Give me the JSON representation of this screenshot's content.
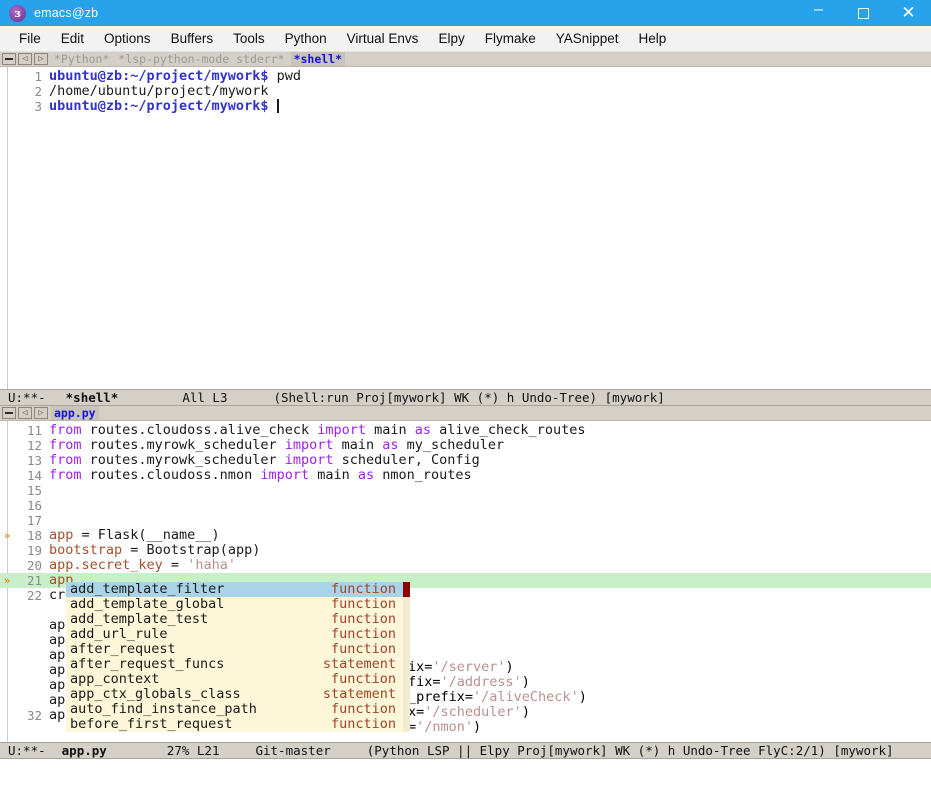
{
  "window": {
    "title": "emacs@zb",
    "icon": "emacs-icon",
    "controls": {
      "minimize": "–",
      "maximize": "□",
      "close": "✕"
    }
  },
  "menubar": {
    "items": [
      "File",
      "Edit",
      "Options",
      "Buffers",
      "Tools",
      "Python",
      "Virtual Envs",
      "Elpy",
      "Flymake",
      "YASnippet",
      "Help"
    ]
  },
  "top_pane": {
    "tabline": {
      "buttons": [
        "▬",
        "◁",
        "▷"
      ],
      "tabs": [
        {
          "label": "*Python*",
          "selected": false
        },
        {
          "label": "*lsp-python-mode stderr*",
          "selected": false
        },
        {
          "label": "*shell*",
          "selected": true
        }
      ]
    },
    "lines": [
      {
        "num": "1",
        "prompt": "ubuntu@zb:~/project/mywork$",
        "cmd": " pwd"
      },
      {
        "num": "2",
        "prompt": "",
        "cmd": "/home/ubuntu/project/mywork"
      },
      {
        "num": "3",
        "prompt": "ubuntu@zb:~/project/mywork$",
        "cmd": " "
      }
    ],
    "modeline": {
      "flags": "U:**-",
      "buffer": "*shell*",
      "position": "All L3",
      "modes": "(Shell:run Proj[mywork] WK (*) h Undo-Tree) [mywork]"
    }
  },
  "bottom_pane": {
    "tabline": {
      "buttons": [
        "▬",
        "◁",
        "▷"
      ],
      "tabs": [
        {
          "label": "app.py",
          "selected": true
        }
      ]
    },
    "code_lines": [
      {
        "num": "11",
        "marker": "",
        "tokens": [
          {
            "t": "from ",
            "c": "kw"
          },
          {
            "t": "routes.cloudoss.alive_check ",
            "c": "plain"
          },
          {
            "t": "import ",
            "c": "kw"
          },
          {
            "t": "main ",
            "c": "plain"
          },
          {
            "t": "as ",
            "c": "kw"
          },
          {
            "t": "alive_check_routes",
            "c": "plain"
          }
        ]
      },
      {
        "num": "12",
        "marker": "",
        "tokens": [
          {
            "t": "from ",
            "c": "kw"
          },
          {
            "t": "routes.myrowk_scheduler ",
            "c": "plain"
          },
          {
            "t": "import ",
            "c": "kw"
          },
          {
            "t": "main ",
            "c": "plain"
          },
          {
            "t": "as ",
            "c": "kw"
          },
          {
            "t": "my_scheduler",
            "c": "plain"
          }
        ]
      },
      {
        "num": "13",
        "marker": "",
        "tokens": [
          {
            "t": "from ",
            "c": "kw"
          },
          {
            "t": "routes.myrowk_scheduler ",
            "c": "plain"
          },
          {
            "t": "import ",
            "c": "kw"
          },
          {
            "t": "scheduler, Config",
            "c": "plain"
          }
        ]
      },
      {
        "num": "14",
        "marker": "",
        "tokens": [
          {
            "t": "from ",
            "c": "kw"
          },
          {
            "t": "routes.cloudoss.nmon ",
            "c": "plain"
          },
          {
            "t": "import ",
            "c": "kw"
          },
          {
            "t": "main ",
            "c": "plain"
          },
          {
            "t": "as ",
            "c": "kw"
          },
          {
            "t": "nmon_routes",
            "c": "plain"
          }
        ]
      },
      {
        "num": "15",
        "marker": "",
        "tokens": []
      },
      {
        "num": "16",
        "marker": "",
        "tokens": []
      },
      {
        "num": "17",
        "marker": "",
        "tokens": []
      },
      {
        "num": "18",
        "marker": "»",
        "tokens": [
          {
            "t": "app",
            "c": "varo"
          },
          {
            "t": " = Flask(__name__)",
            "c": "plain"
          }
        ]
      },
      {
        "num": "19",
        "marker": "",
        "tokens": [
          {
            "t": "bootstrap",
            "c": "varo"
          },
          {
            "t": " = Bootstrap(app)",
            "c": "plain"
          }
        ]
      },
      {
        "num": "20",
        "marker": "",
        "tokens": [
          {
            "t": "app.secret_key",
            "c": "varo"
          },
          {
            "t": " = ",
            "c": "plain"
          },
          {
            "t": "'haha'",
            "c": "str"
          }
        ]
      },
      {
        "num": "21",
        "marker": "»",
        "highlight": true,
        "tokens": [
          {
            "t": "app.",
            "c": "varo"
          }
        ]
      },
      {
        "num": "22",
        "marker": "",
        "tokens": [
          {
            "t": "cre",
            "c": "plain"
          }
        ]
      },
      {
        "num": "",
        "marker": "",
        "tokens": []
      },
      {
        "num": "",
        "marker": "",
        "tokens": [
          {
            "t": "app",
            "c": "plain"
          }
        ]
      },
      {
        "num": "",
        "marker": "",
        "tokens": [
          {
            "t": "app",
            "c": "plain"
          }
        ]
      },
      {
        "num": "",
        "marker": "",
        "tokens": [
          {
            "t": "app",
            "c": "plain"
          }
        ]
      },
      {
        "num": "",
        "marker": "",
        "tokens": [
          {
            "t": "app",
            "c": "plain"
          }
        ]
      },
      {
        "num": "",
        "marker": "",
        "tokens": [
          {
            "t": "app",
            "c": "plain"
          }
        ]
      },
      {
        "num": "",
        "marker": "",
        "tokens": [
          {
            "t": "app",
            "c": "plain"
          }
        ]
      },
      {
        "num": "32",
        "marker": "",
        "tokens": [
          {
            "t": "app.config.from object(Config())",
            "c": "plain"
          }
        ]
      }
    ],
    "obscured_tails": [
      {
        "pre": "ix=",
        "str": "'/server'",
        "post": ")"
      },
      {
        "pre": "fix=",
        "str": "'/address'",
        "post": ")"
      },
      {
        "pre": "_prefix=",
        "str": "'/aliveCheck'",
        "post": ")"
      },
      {
        "pre": "x=",
        "str": "'/scheduler'",
        "post": ")"
      },
      {
        "pre": "=",
        "str": "'/nmon'",
        "post": ")"
      }
    ],
    "autocomplete": {
      "items": [
        {
          "name": "add_template_filter",
          "annotation": "function",
          "selected": true
        },
        {
          "name": "add_template_global",
          "annotation": "function",
          "selected": false
        },
        {
          "name": "add_template_test",
          "annotation": "function",
          "selected": false
        },
        {
          "name": "add_url_rule",
          "annotation": "function",
          "selected": false
        },
        {
          "name": "after_request",
          "annotation": "function",
          "selected": false
        },
        {
          "name": "after_request_funcs",
          "annotation": "statement",
          "selected": false
        },
        {
          "name": "app_context",
          "annotation": "function",
          "selected": false
        },
        {
          "name": "app_ctx_globals_class",
          "annotation": "statement",
          "selected": false
        },
        {
          "name": "auto_find_instance_path",
          "annotation": "function",
          "selected": false
        },
        {
          "name": "before_first_request",
          "annotation": "function",
          "selected": false
        }
      ]
    },
    "modeline": {
      "flags": "U:**-",
      "buffer": "app.py",
      "position": "27% L21",
      "vc": "Git-master",
      "modes": "(Python LSP || Elpy Proj[mywork] WK (*) h Undo-Tree FlyC:2/1) [mywork]"
    }
  },
  "colors": {
    "titlebar": "#27a3eb",
    "menubar": "#f2f2f2",
    "modeline": "#d4d0c8",
    "keyword": "#a020f0",
    "variable": "#a0522d",
    "string": "#bc8f8f",
    "prompt": "#3333cc",
    "highlight_line": "#c8f0c8",
    "popup_bg": "#fdf6d8",
    "popup_sel": "#a9d4e8",
    "popup_annotation": "#a0432a",
    "scrollbar": "#8b0000"
  }
}
